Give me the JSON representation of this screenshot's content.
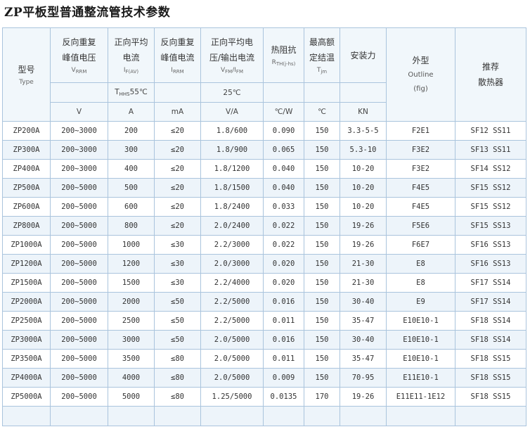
{
  "title": "ZP平板型普通整流管技术参数",
  "header": {
    "model_cn": "型号",
    "model_en": "Type",
    "vrrm_l1": "反向重复",
    "vrrm_l2": "峰值电压",
    "vrrm_sym": "V",
    "vrrm_sub": "RRM",
    "ifav_l1": "正向平均",
    "ifav_l2": "电流",
    "ifav_sym": "I",
    "ifav_sub": "F(AV)",
    "irrm_l1": "反向重复",
    "irrm_l2": "峰值电流",
    "irrm_sym": "I",
    "irrm_sub": "RRM",
    "vfm_l1": "正向平均电",
    "vfm_l2": "压/输出电流",
    "vfm_sym": "V",
    "vfm_sub1": "FM",
    "vfm_sep": "/I",
    "vfm_sub2": "FM",
    "rth_l1": "热阻抗",
    "rth_sym": "R",
    "rth_sub": "TH(j-hs)",
    "tjm_l1": "最高额",
    "tjm_l2": "定结温",
    "tjm_sym": "T",
    "tjm_sub": "jm",
    "force": "安装力",
    "outline_cn": "外型",
    "outline_en": "Outline",
    "outline_fig": "(fig)",
    "heatsink_l1": "推荐",
    "heatsink_l2": "散热器",
    "cond_ths_sym": "T",
    "cond_ths_sub": "HHS",
    "cond_ths_val": "55℃",
    "cond_25": "25℃"
  },
  "units": [
    "V",
    "A",
    "mA",
    "V/A",
    "℃/W",
    "℃",
    "KN"
  ],
  "rows": [
    {
      "type": "ZP200A",
      "vrrm": "200~3000",
      "ifav": "200",
      "irrm": "≤20",
      "vfm": "1.8/600",
      "rth": "0.090",
      "tjm": "150",
      "force": "3.3-5-5",
      "outline": "F2E1",
      "heatsink": "SF12 SS11"
    },
    {
      "type": "ZP300A",
      "vrrm": "200~3000",
      "ifav": "300",
      "irrm": "≤20",
      "vfm": "1.8/900",
      "rth": "0.065",
      "tjm": "150",
      "force": "5.3-10",
      "outline": "F3E2",
      "heatsink": "SF13 SS11"
    },
    {
      "type": "ZP400A",
      "vrrm": "200~3000",
      "ifav": "400",
      "irrm": "≤20",
      "vfm": "1.8/1200",
      "rth": "0.040",
      "tjm": "150",
      "force": "10-20",
      "outline": "F3E2",
      "heatsink": "SF14 SS12"
    },
    {
      "type": "ZP500A",
      "vrrm": "200~5000",
      "ifav": "500",
      "irrm": "≤20",
      "vfm": "1.8/1500",
      "rth": "0.040",
      "tjm": "150",
      "force": "10-20",
      "outline": "F4E5",
      "heatsink": "SF15 SS12"
    },
    {
      "type": "ZP600A",
      "vrrm": "200~5000",
      "ifav": "600",
      "irrm": "≤20",
      "vfm": "1.8/2400",
      "rth": "0.033",
      "tjm": "150",
      "force": "10-20",
      "outline": "F4E5",
      "heatsink": "SF15 SS12"
    },
    {
      "type": "ZP800A",
      "vrrm": "200~5000",
      "ifav": "800",
      "irrm": "≤20",
      "vfm": "2.0/2400",
      "rth": "0.022",
      "tjm": "150",
      "force": "19-26",
      "outline": "F5E6",
      "heatsink": "SF15 SS13"
    },
    {
      "type": "ZP1000A",
      "vrrm": "200~5000",
      "ifav": "1000",
      "irrm": "≤30",
      "vfm": "2.2/3000",
      "rth": "0.022",
      "tjm": "150",
      "force": "19-26",
      "outline": "F6E7",
      "heatsink": "SF16 SS13"
    },
    {
      "type": "ZP1200A",
      "vrrm": "200~5000",
      "ifav": "1200",
      "irrm": "≤30",
      "vfm": "2.0/3000",
      "rth": "0.020",
      "tjm": "150",
      "force": "21-30",
      "outline": "E8",
      "heatsink": "SF16 SS13"
    },
    {
      "type": "ZP1500A",
      "vrrm": "200~5000",
      "ifav": "1500",
      "irrm": "≤30",
      "vfm": "2.2/4000",
      "rth": "0.020",
      "tjm": "150",
      "force": "21-30",
      "outline": "E8",
      "heatsink": "SF17 SS14"
    },
    {
      "type": "ZP2000A",
      "vrrm": "200~5000",
      "ifav": "2000",
      "irrm": "≤50",
      "vfm": "2.2/5000",
      "rth": "0.016",
      "tjm": "150",
      "force": "30-40",
      "outline": "E9",
      "heatsink": "SF17 SS14"
    },
    {
      "type": "ZP2500A",
      "vrrm": "200~5000",
      "ifav": "2500",
      "irrm": "≤50",
      "vfm": "2.2/5000",
      "rth": "0.011",
      "tjm": "150",
      "force": "35-47",
      "outline": "E10E10-1",
      "heatsink": "SF18 SS14"
    },
    {
      "type": "ZP3000A",
      "vrrm": "200~5000",
      "ifav": "3000",
      "irrm": "≤50",
      "vfm": "2.0/5000",
      "rth": "0.016",
      "tjm": "150",
      "force": "30-40",
      "outline": "E10E10-1",
      "heatsink": "SF18 SS14"
    },
    {
      "type": "ZP3500A",
      "vrrm": "200~5000",
      "ifav": "3500",
      "irrm": "≤80",
      "vfm": "2.0/5000",
      "rth": "0.011",
      "tjm": "150",
      "force": "35-47",
      "outline": "E10E10-1",
      "heatsink": "SF18 SS15"
    },
    {
      "type": "ZP4000A",
      "vrrm": "200~5000",
      "ifav": "4000",
      "irrm": "≤80",
      "vfm": "2.0/5000",
      "rth": "0.009",
      "tjm": "150",
      "force": "70-95",
      "outline": "E11E10-1",
      "heatsink": "SF18 SS15"
    },
    {
      "type": "ZP5000A",
      "vrrm": "200~5000",
      "ifav": "5000",
      "irrm": "≤80",
      "vfm": "1.25/5000",
      "rth": "0.0135",
      "tjm": "170",
      "force": "19-26",
      "outline": "E11E11-1E12",
      "heatsink": "SF18 SS15"
    }
  ]
}
